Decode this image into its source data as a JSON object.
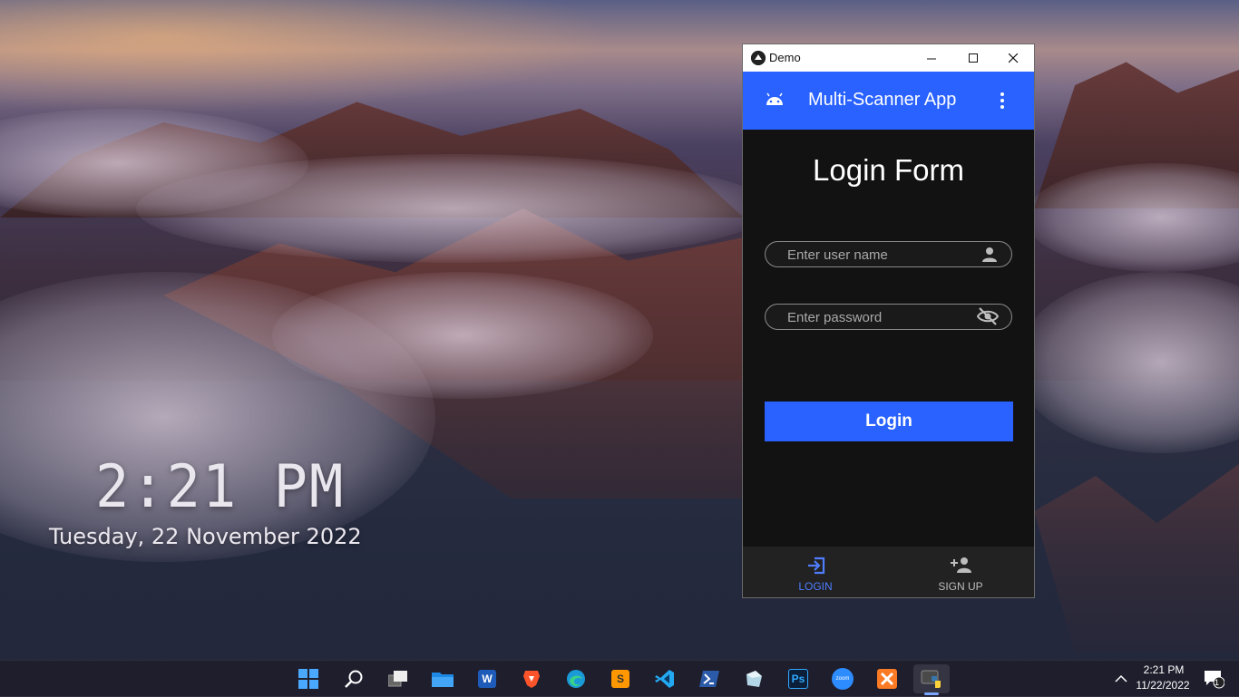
{
  "desktop": {
    "clock_time": "2:21 PM",
    "clock_date": "Tuesday, 22 November 2022"
  },
  "window": {
    "title": "Demo",
    "controls": {
      "minimize": "minimize-icon",
      "maximize": "maximize-icon",
      "close": "close-icon"
    }
  },
  "app": {
    "toolbar_title": "Multi-Scanner App",
    "accent_color": "#2962ff",
    "background_color": "#121212",
    "form_title": "Login Form",
    "username": {
      "placeholder": "Enter user name",
      "value": "",
      "icon": "person-icon"
    },
    "password": {
      "placeholder": "Enter password",
      "value": "",
      "icon": "visibility-off-icon"
    },
    "login_button": "Login",
    "nav": [
      {
        "label": "LOGIN",
        "icon": "login-icon",
        "active": true
      },
      {
        "label": "SIGN UP",
        "icon": "person-add-icon",
        "active": false
      }
    ]
  },
  "taskbar": {
    "apps": [
      {
        "name": "start",
        "icon": "windows-start-icon"
      },
      {
        "name": "search",
        "icon": "search-icon"
      },
      {
        "name": "task-view",
        "icon": "task-view-icon"
      },
      {
        "name": "file-explorer",
        "icon": "folder-icon"
      },
      {
        "name": "word",
        "icon": "word-icon"
      },
      {
        "name": "brave",
        "icon": "brave-icon"
      },
      {
        "name": "edge",
        "icon": "edge-icon"
      },
      {
        "name": "sublime-text",
        "icon": "sublime-icon"
      },
      {
        "name": "vscode",
        "icon": "vscode-icon"
      },
      {
        "name": "powershell",
        "icon": "powershell-icon"
      },
      {
        "name": "app",
        "icon": "cube-icon"
      },
      {
        "name": "photoshop",
        "icon": "photoshop-icon"
      },
      {
        "name": "zoom",
        "icon": "zoom-icon"
      },
      {
        "name": "xampp",
        "icon": "xampp-icon"
      },
      {
        "name": "python",
        "icon": "python-icon",
        "active": true
      }
    ],
    "tile_labels": {
      "word": "W",
      "sublime": "S",
      "photoshop": "Ps",
      "zoom": "zoom"
    },
    "tray": {
      "time": "2:21 PM",
      "date": "11/22/2022",
      "notification_count": "1"
    }
  }
}
